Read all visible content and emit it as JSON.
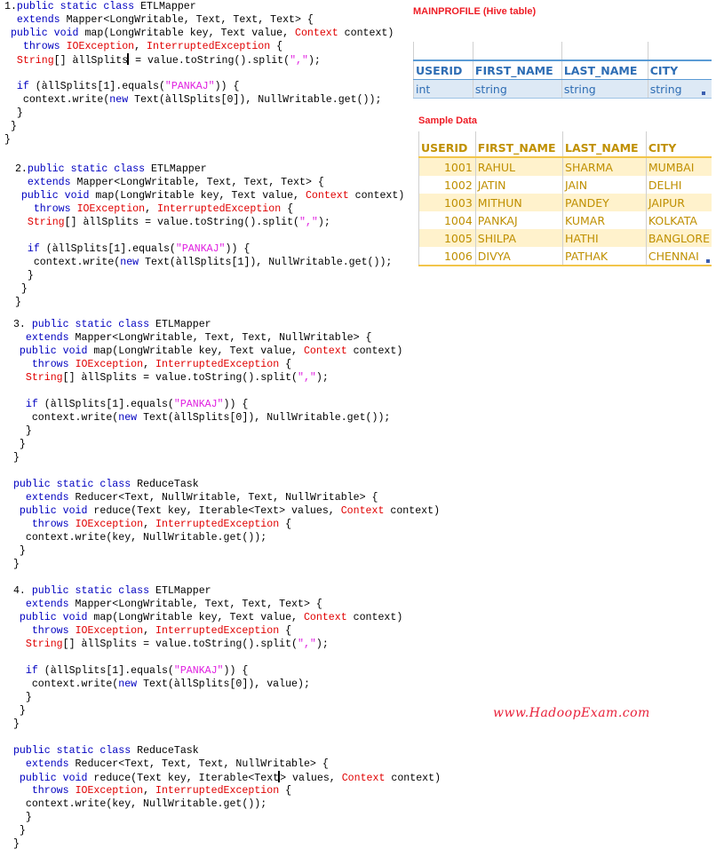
{
  "questions": [
    {
      "id": "q1",
      "lines": [
        [
          {
            "t": "1.",
            "c": ""
          },
          {
            "t": "public static class",
            "c": "kw"
          },
          {
            "t": " ETLMapper",
            "c": ""
          }
        ],
        [
          {
            "t": "  ",
            "c": ""
          },
          {
            "t": "extends",
            "c": "kw"
          },
          {
            "t": " Mapper<LongWritable, Text, Text, Text> {",
            "c": ""
          }
        ],
        [
          {
            "t": " ",
            "c": ""
          },
          {
            "t": "public void",
            "c": "kw"
          },
          {
            "t": " map(LongWritable key, Text value, ",
            "c": ""
          },
          {
            "t": "Context",
            "c": "ex"
          },
          {
            "t": " context)",
            "c": ""
          }
        ],
        [
          {
            "t": "   ",
            "c": ""
          },
          {
            "t": "throws",
            "c": "kw"
          },
          {
            "t": " ",
            "c": ""
          },
          {
            "t": "IOException",
            "c": "ex"
          },
          {
            "t": ", ",
            "c": ""
          },
          {
            "t": "InterruptedException",
            "c": "ex"
          },
          {
            "t": " {",
            "c": ""
          }
        ],
        [
          {
            "t": "  ",
            "c": ""
          },
          {
            "t": "String",
            "c": "ex"
          },
          {
            "t": "[] àllSplits",
            "c": ""
          },
          {
            "t": "|",
            "c": "caret"
          },
          {
            "t": " = value.toString().split(",
            "c": ""
          },
          {
            "t": "\",\"",
            "c": "str"
          },
          {
            "t": ");",
            "c": ""
          }
        ],
        [],
        [
          {
            "t": "  ",
            "c": ""
          },
          {
            "t": "if",
            "c": "kw"
          },
          {
            "t": " (àllSplits[1].equals(",
            "c": ""
          },
          {
            "t": "\"PANKAJ\"",
            "c": "str"
          },
          {
            "t": ")) {",
            "c": ""
          }
        ],
        [
          {
            "t": "   context.write(",
            "c": ""
          },
          {
            "t": "new",
            "c": "kw"
          },
          {
            "t": " Text(àllSplits[0]), NullWritable.get());",
            "c": ""
          }
        ],
        [
          {
            "t": "  }",
            "c": ""
          }
        ],
        [
          {
            "t": " }",
            "c": ""
          }
        ],
        [
          {
            "t": "}",
            "c": ""
          }
        ]
      ]
    },
    {
      "id": "q2",
      "lines": [
        [
          {
            "t": " 2.",
            "c": ""
          },
          {
            "t": "public static class",
            "c": "kw"
          },
          {
            "t": " ETLMapper",
            "c": ""
          }
        ],
        [
          {
            "t": "   ",
            "c": ""
          },
          {
            "t": "extends",
            "c": "kw"
          },
          {
            "t": " Mapper<LongWritable, Text, Text, Text> {",
            "c": ""
          }
        ],
        [
          {
            "t": "  ",
            "c": ""
          },
          {
            "t": "public void",
            "c": "kw"
          },
          {
            "t": " map(LongWritable key, Text value, ",
            "c": ""
          },
          {
            "t": "Context",
            "c": "ex"
          },
          {
            "t": " context)",
            "c": ""
          }
        ],
        [
          {
            "t": "    ",
            "c": ""
          },
          {
            "t": "throws",
            "c": "kw"
          },
          {
            "t": " ",
            "c": ""
          },
          {
            "t": "IOException",
            "c": "ex"
          },
          {
            "t": ", ",
            "c": ""
          },
          {
            "t": "InterruptedException",
            "c": "ex"
          },
          {
            "t": " {",
            "c": ""
          }
        ],
        [
          {
            "t": "   ",
            "c": ""
          },
          {
            "t": "String",
            "c": "ex"
          },
          {
            "t": "[] àllSplits = value.toString().split(",
            "c": ""
          },
          {
            "t": "\",\"",
            "c": "str"
          },
          {
            "t": ");",
            "c": ""
          }
        ],
        [],
        [
          {
            "t": "   ",
            "c": ""
          },
          {
            "t": "if",
            "c": "kw"
          },
          {
            "t": " (àllSplits[1].equals(",
            "c": ""
          },
          {
            "t": "\"PANKAJ\"",
            "c": "str"
          },
          {
            "t": ")) {",
            "c": ""
          }
        ],
        [
          {
            "t": "    context.write(",
            "c": ""
          },
          {
            "t": "new",
            "c": "kw"
          },
          {
            "t": " Text(àllSplits[1]), NullWritable.get());",
            "c": ""
          }
        ],
        [
          {
            "t": "   }",
            "c": ""
          }
        ],
        [
          {
            "t": "  }",
            "c": ""
          }
        ],
        [
          {
            "t": " }",
            "c": ""
          }
        ]
      ]
    },
    {
      "id": "q3",
      "lines": [
        [
          {
            "t": " 3. ",
            "c": ""
          },
          {
            "t": "public static class",
            "c": "kw"
          },
          {
            "t": " ETLMapper",
            "c": ""
          }
        ],
        [
          {
            "t": "   ",
            "c": ""
          },
          {
            "t": "extends",
            "c": "kw"
          },
          {
            "t": " Mapper<LongWritable, Text, Text, NullWritable> {",
            "c": ""
          }
        ],
        [
          {
            "t": "  ",
            "c": ""
          },
          {
            "t": "public void",
            "c": "kw"
          },
          {
            "t": " map(LongWritable key, Text value, ",
            "c": ""
          },
          {
            "t": "Context",
            "c": "ex"
          },
          {
            "t": " context)",
            "c": ""
          }
        ],
        [
          {
            "t": "    ",
            "c": ""
          },
          {
            "t": "throws",
            "c": "kw"
          },
          {
            "t": " ",
            "c": ""
          },
          {
            "t": "IOException",
            "c": "ex"
          },
          {
            "t": ", ",
            "c": ""
          },
          {
            "t": "InterruptedException",
            "c": "ex"
          },
          {
            "t": " {",
            "c": ""
          }
        ],
        [
          {
            "t": "   ",
            "c": ""
          },
          {
            "t": "String",
            "c": "ex"
          },
          {
            "t": "[] àllSplits = value.toString().split(",
            "c": ""
          },
          {
            "t": "\",\"",
            "c": "str"
          },
          {
            "t": ");",
            "c": ""
          }
        ],
        [],
        [
          {
            "t": "   ",
            "c": ""
          },
          {
            "t": "if",
            "c": "kw"
          },
          {
            "t": " (àllSplits[1].equals(",
            "c": ""
          },
          {
            "t": "\"PANKAJ\"",
            "c": "str"
          },
          {
            "t": ")) {",
            "c": ""
          }
        ],
        [
          {
            "t": "    context.write(",
            "c": ""
          },
          {
            "t": "new",
            "c": "kw"
          },
          {
            "t": " Text(àllSplits[0]), NullWritable.get());",
            "c": ""
          }
        ],
        [
          {
            "t": "   }",
            "c": ""
          }
        ],
        [
          {
            "t": "  }",
            "c": ""
          }
        ],
        [
          {
            "t": " }",
            "c": ""
          }
        ]
      ]
    },
    {
      "id": "q3-reducer",
      "lines": [
        [
          {
            "t": " ",
            "c": ""
          },
          {
            "t": "public static class",
            "c": "kw"
          },
          {
            "t": " ReduceTask",
            "c": ""
          }
        ],
        [
          {
            "t": "   ",
            "c": ""
          },
          {
            "t": "extends",
            "c": "kw"
          },
          {
            "t": " Reducer<Text, NullWritable, Text, NullWritable> {",
            "c": ""
          }
        ],
        [
          {
            "t": "  ",
            "c": ""
          },
          {
            "t": "public void",
            "c": "kw"
          },
          {
            "t": " reduce(Text key, Iterable<Text> values, ",
            "c": ""
          },
          {
            "t": "Context",
            "c": "ex"
          },
          {
            "t": " context)",
            "c": ""
          }
        ],
        [
          {
            "t": "    ",
            "c": ""
          },
          {
            "t": "throws",
            "c": "kw"
          },
          {
            "t": " ",
            "c": ""
          },
          {
            "t": "IOException",
            "c": "ex"
          },
          {
            "t": ", ",
            "c": ""
          },
          {
            "t": "InterruptedException",
            "c": "ex"
          },
          {
            "t": " {",
            "c": ""
          }
        ],
        [
          {
            "t": "   context.write(key, NullWritable.get());",
            "c": ""
          }
        ],
        [
          {
            "t": "  }",
            "c": ""
          }
        ],
        [
          {
            "t": " }",
            "c": ""
          }
        ]
      ]
    },
    {
      "id": "q4",
      "lines": [
        [
          {
            "t": " 4. ",
            "c": ""
          },
          {
            "t": "public static class",
            "c": "kw"
          },
          {
            "t": " ETLMapper",
            "c": ""
          }
        ],
        [
          {
            "t": "   ",
            "c": ""
          },
          {
            "t": "extends",
            "c": "kw"
          },
          {
            "t": " Mapper<LongWritable, Text, Text, Text> {",
            "c": ""
          }
        ],
        [
          {
            "t": "  ",
            "c": ""
          },
          {
            "t": "public void",
            "c": "kw"
          },
          {
            "t": " map(LongWritable key, Text value, ",
            "c": ""
          },
          {
            "t": "Context",
            "c": "ex"
          },
          {
            "t": " context)",
            "c": ""
          }
        ],
        [
          {
            "t": "    ",
            "c": ""
          },
          {
            "t": "throws",
            "c": "kw"
          },
          {
            "t": " ",
            "c": ""
          },
          {
            "t": "IOException",
            "c": "ex"
          },
          {
            "t": ", ",
            "c": ""
          },
          {
            "t": "InterruptedException",
            "c": "ex"
          },
          {
            "t": " {",
            "c": ""
          }
        ],
        [
          {
            "t": "   ",
            "c": ""
          },
          {
            "t": "String",
            "c": "ex"
          },
          {
            "t": "[] àllSplits = value.toString().split(",
            "c": ""
          },
          {
            "t": "\",\"",
            "c": "str"
          },
          {
            "t": ");",
            "c": ""
          }
        ],
        [],
        [
          {
            "t": "   ",
            "c": ""
          },
          {
            "t": "if",
            "c": "kw"
          },
          {
            "t": " (àllSplits[1].equals(",
            "c": ""
          },
          {
            "t": "\"PANKAJ\"",
            "c": "str"
          },
          {
            "t": ")) {",
            "c": ""
          }
        ],
        [
          {
            "t": "    context.write(",
            "c": ""
          },
          {
            "t": "new",
            "c": "kw"
          },
          {
            "t": " Text(àllSplits[0]), value);",
            "c": ""
          }
        ],
        [
          {
            "t": "   }",
            "c": ""
          }
        ],
        [
          {
            "t": "  }",
            "c": ""
          }
        ],
        [
          {
            "t": " }",
            "c": ""
          }
        ]
      ]
    },
    {
      "id": "q4-reducer",
      "lines": [
        [
          {
            "t": " ",
            "c": ""
          },
          {
            "t": "public static class",
            "c": "kw"
          },
          {
            "t": " ReduceTask",
            "c": ""
          }
        ],
        [
          {
            "t": "   ",
            "c": ""
          },
          {
            "t": "extends",
            "c": "kw"
          },
          {
            "t": " Reducer<Text, Text, Text, NullWritable> {",
            "c": ""
          }
        ],
        [
          {
            "t": "  ",
            "c": ""
          },
          {
            "t": "public void",
            "c": "kw"
          },
          {
            "t": " reduce(Text key, Iterable<Text",
            "c": ""
          },
          {
            "t": "|",
            "c": "caret"
          },
          {
            "t": "> values, ",
            "c": ""
          },
          {
            "t": "Context",
            "c": "ex"
          },
          {
            "t": " context)",
            "c": ""
          }
        ],
        [
          {
            "t": "    ",
            "c": ""
          },
          {
            "t": "throws",
            "c": "kw"
          },
          {
            "t": " ",
            "c": ""
          },
          {
            "t": "IOException",
            "c": "ex"
          },
          {
            "t": ", ",
            "c": ""
          },
          {
            "t": "InterruptedException",
            "c": "ex"
          },
          {
            "t": " {",
            "c": ""
          }
        ],
        [
          {
            "t": "   context.write(key, NullWritable.get());",
            "c": ""
          }
        ],
        [
          {
            "t": "   }",
            "c": ""
          }
        ],
        [
          {
            "t": "  }",
            "c": ""
          }
        ],
        [
          {
            "t": " }",
            "c": ""
          }
        ]
      ]
    }
  ],
  "schema_table": {
    "title": "MAINPROFILE (Hive table)",
    "columns": [
      "USERID",
      "FIRST_NAME",
      "LAST_NAME",
      "CITY"
    ],
    "types": [
      "int",
      "string",
      "string",
      "string"
    ]
  },
  "sample_table": {
    "title": "Sample Data",
    "columns": [
      "USERID",
      "FIRST_NAME",
      "LAST_NAME",
      "CITY"
    ],
    "rows": [
      [
        "1001",
        "RAHUL",
        "SHARMA",
        "MUMBAI"
      ],
      [
        "1002",
        "JATIN",
        "JAIN",
        "DELHI"
      ],
      [
        "1003",
        "MITHUN",
        "PANDEY",
        "JAIPUR"
      ],
      [
        "1004",
        "PANKAJ",
        "KUMAR",
        "KOLKATA"
      ],
      [
        "1005",
        "SHILPA",
        "HATHI",
        "BANGLORE"
      ],
      [
        "1006",
        "DIVYA",
        "PATHAK",
        "CHENNAI"
      ]
    ]
  },
  "watermark": "www.HadoopExam.com",
  "colors": {
    "keyword": "#0000c0",
    "exception": "#e00000",
    "string_literal": "#e020e0",
    "title_red": "#ee1c25",
    "schema_blue": "#2e6db4",
    "sample_gold": "#bf8f00"
  }
}
